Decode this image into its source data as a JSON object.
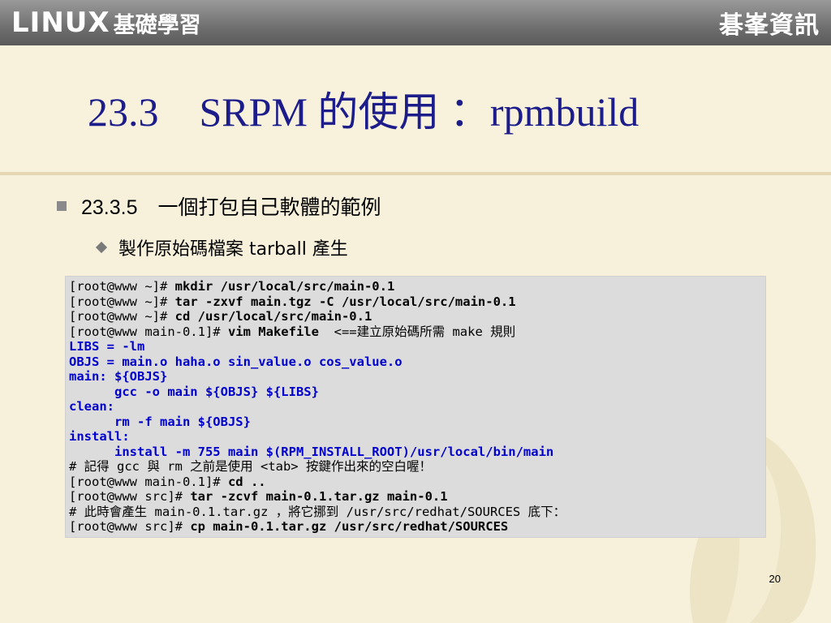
{
  "header": {
    "logo_linux": "LINUX",
    "logo_sub": "基礎學習",
    "logo_right": "碁峯資訊"
  },
  "title": "23.3　SRPM 的使用 ：rpmbuild",
  "bullets": {
    "level1": "23.3.5　一個打包自己軟體的範例",
    "level2": "製作原始碼檔案 tarball 產生"
  },
  "code_lines": [
    {
      "prompt": "[root@www ~]# ",
      "cmd": "mkdir /usr/local/src/main-0.1",
      "note": "",
      "style": "shell"
    },
    {
      "prompt": "[root@www ~]# ",
      "cmd": "tar -zxvf main.tgz -C /usr/local/src/main-0.1",
      "note": "",
      "style": "shell"
    },
    {
      "prompt": "[root@www ~]# ",
      "cmd": "cd /usr/local/src/main-0.1",
      "note": "",
      "style": "shell"
    },
    {
      "prompt": "[root@www main-0.1]# ",
      "cmd": "vim Makefile",
      "note": "  <==建立原始碼所需 make 規則",
      "style": "shell"
    },
    {
      "prompt": "",
      "cmd": "LIBS = -lm",
      "note": "",
      "style": "make"
    },
    {
      "prompt": "",
      "cmd": "OBJS = main.o haha.o sin_value.o cos_value.o",
      "note": "",
      "style": "make"
    },
    {
      "prompt": "",
      "cmd": "main: ${OBJS}",
      "note": "",
      "style": "make"
    },
    {
      "prompt": "",
      "cmd": "      gcc -o main ${OBJS} ${LIBS}",
      "note": "",
      "style": "make"
    },
    {
      "prompt": "",
      "cmd": "clean:",
      "note": "",
      "style": "make"
    },
    {
      "prompt": "",
      "cmd": "      rm -f main ${OBJS}",
      "note": "",
      "style": "make"
    },
    {
      "prompt": "",
      "cmd": "install:",
      "note": "",
      "style": "make"
    },
    {
      "prompt": "",
      "cmd": "      install -m 755 main $(RPM_INSTALL_ROOT)/usr/local/bin/main",
      "note": "",
      "style": "make"
    },
    {
      "prompt": "",
      "cmd": "",
      "note": "# 記得 gcc 與 rm 之前是使用 <tab> 按鍵作出來的空白喔！",
      "style": "comment"
    },
    {
      "prompt": "[root@www main-0.1]# ",
      "cmd": "cd ..",
      "note": "",
      "style": "shell"
    },
    {
      "prompt": "[root@www src]# ",
      "cmd": "tar -zcvf main-0.1.tar.gz main-0.1",
      "note": "",
      "style": "shell"
    },
    {
      "prompt": "",
      "cmd": "",
      "note": "# 此時會產生 main-0.1.tar.gz ，將它挪到 /usr/src/redhat/SOURCES 底下：",
      "style": "comment"
    },
    {
      "prompt": "[root@www src]# ",
      "cmd": "cp main-0.1.tar.gz /usr/src/redhat/SOURCES",
      "note": "",
      "style": "shell"
    }
  ],
  "page_number": "20",
  "colors": {
    "title": "#1c1c8a",
    "makefile": "#0000cc",
    "code_bg": "#dcdcdc"
  }
}
